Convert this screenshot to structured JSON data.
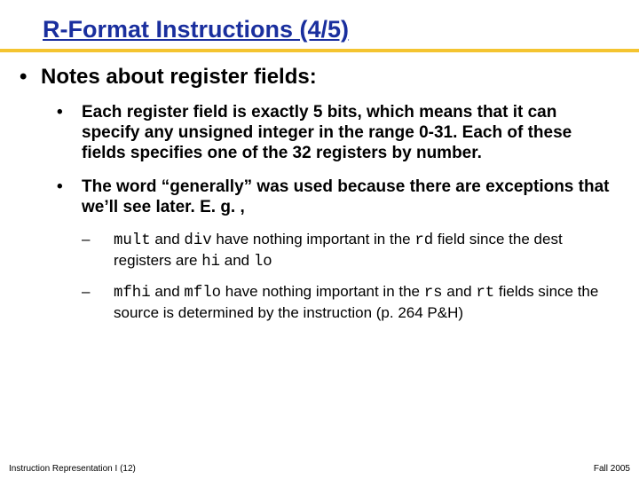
{
  "title": "R-Format Instructions (4/5)",
  "lvl1": "Notes about register fields:",
  "lvl2a": "Each register field is exactly 5 bits, which means that it can specify any unsigned integer in the range 0-31.  Each of these fields specifies one of the 32 registers by number.",
  "lvl2b": "The word “generally” was used because there are exceptions that we’ll see later.  E. g. ,",
  "lvl3a_pre": "",
  "lvl3a_code1": "mult",
  "lvl3a_mid1": " and ",
  "lvl3a_code2": "div",
  "lvl3a_mid2": " have nothing important in the ",
  "lvl3a_code3": "rd",
  "lvl3a_mid3": " field since the dest registers are ",
  "lvl3a_code4": "hi",
  "lvl3a_mid4": " and ",
  "lvl3a_code5": "lo",
  "lvl3b_code1": "mfhi",
  "lvl3b_mid1": " and ",
  "lvl3b_code2": "mflo",
  "lvl3b_mid2": " have nothing important in the ",
  "lvl3b_code3": "rs",
  "lvl3b_mid3": " and ",
  "lvl3b_code4": "rt",
  "lvl3b_mid4": " fields since the source is determined by the instruction (p. 264 P&H)",
  "footer_left": "Instruction Representation I (12)",
  "footer_right": "Fall 2005"
}
